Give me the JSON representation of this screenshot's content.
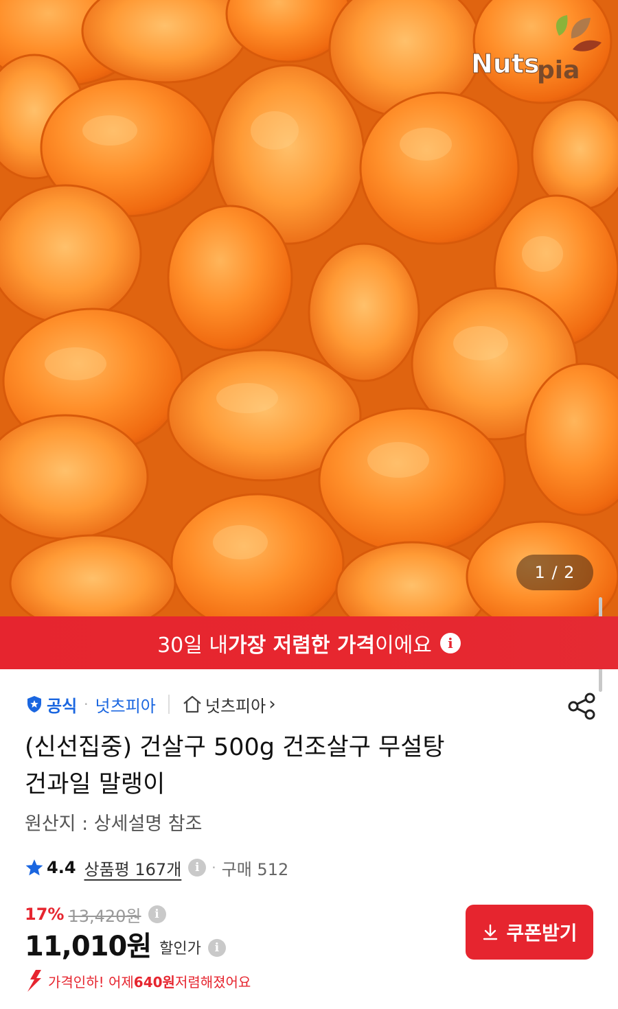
{
  "hero": {
    "image_alt": "dried apricots",
    "brand_logo_text_1": "Nuts",
    "brand_logo_text_2": "pia",
    "page_indicator": "1 / 2"
  },
  "promo_banner": {
    "text_prefix": "30일 내 ",
    "text_bold": "가장 저렴한 가격",
    "text_suffix": "이에요",
    "info_glyph": "i"
  },
  "seller": {
    "official_label": "공식",
    "separator": "·",
    "seller_name": "넛츠피아",
    "store_label": "넛츠피아",
    "store_chevron": "›"
  },
  "product": {
    "title_line1": "(신선집중) 건살구 500g 건조살구 무설탕",
    "title_line2": "건과일 말랭이",
    "origin": "원산지 : 상세설명 참조"
  },
  "rating": {
    "score": "4.4",
    "reviews": "상품평 167개",
    "info_glyph": "i",
    "separator": "·",
    "purchases": "구매 512"
  },
  "price": {
    "discount_rate": "17%",
    "original_price": "13,420원",
    "info_glyph": "i",
    "sale_price": "11,010원",
    "sale_price_label": "할인가"
  },
  "coupon_button": {
    "label": "쿠폰받기"
  },
  "price_drop": {
    "prefix": "가격인하! 어제 ",
    "amount": "640원",
    "suffix": " 저렴해졌어요"
  },
  "colors": {
    "accent_red": "#e6252f",
    "official_blue": "#1a66e0",
    "apricot_orange": "#f07a1c"
  }
}
